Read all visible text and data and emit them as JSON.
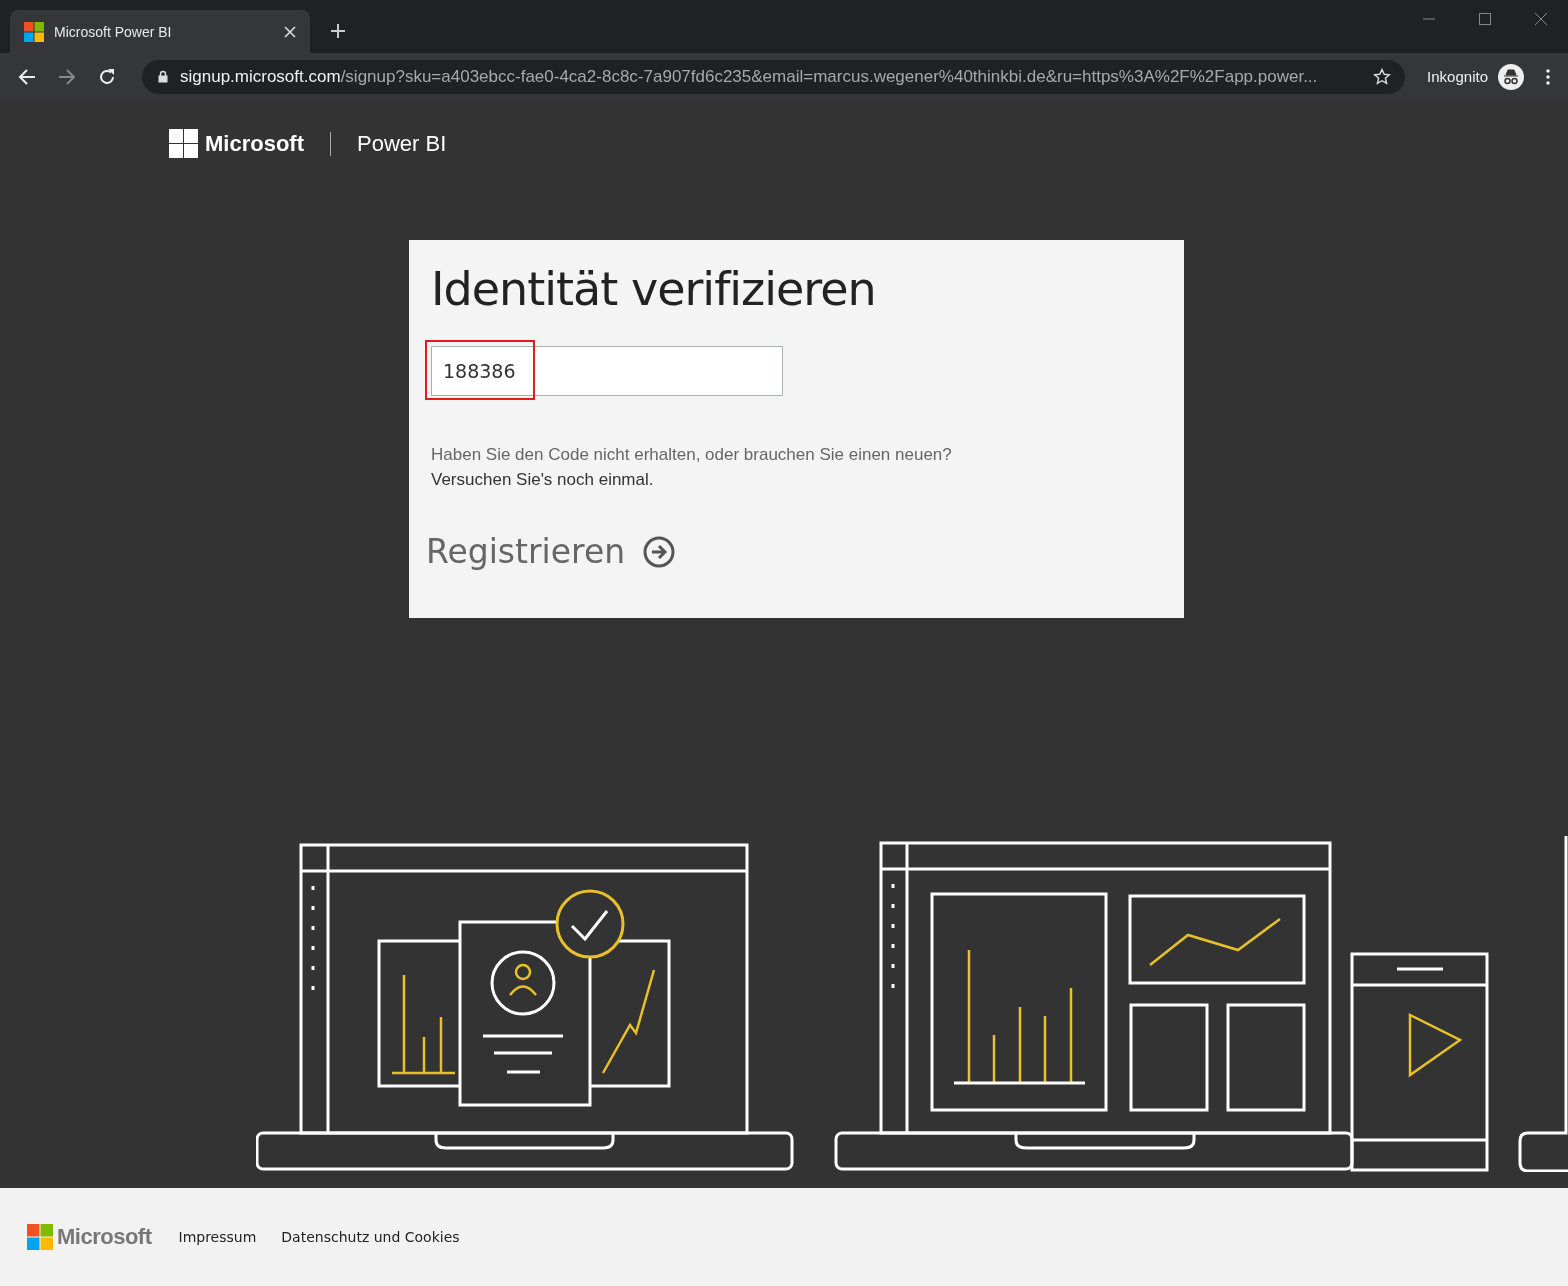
{
  "browser": {
    "tab": {
      "title": "Microsoft Power BI"
    },
    "url_host": "signup.microsoft.com",
    "url_path": "/signup?sku=a403ebcc-fae0-4ca2-8c8c-7a907fd6c235&email=marcus.wegener%40thinkbi.de&ru=https%3A%2F%2Fapp.power...",
    "profile": "Inkognito"
  },
  "header": {
    "brand": "Microsoft",
    "product": "Power BI"
  },
  "card": {
    "title": "Identität verifizieren",
    "code_field": {
      "value": "188386"
    },
    "hint": "Haben Sie den Code nicht erhalten, oder brauchen Sie einen neuen?",
    "hint_link": "Versuchen Sie's noch einmal.",
    "submit": "Registrieren"
  },
  "footer": {
    "brand": "Microsoft",
    "links": [
      "Impressum",
      "Datenschutz und Cookies"
    ]
  }
}
